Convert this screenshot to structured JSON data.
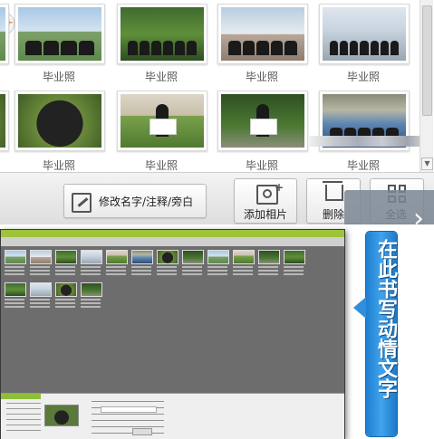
{
  "gallery": {
    "rows": [
      {
        "items": [
          {
            "caption": "毕业照",
            "scene": "jumping-students"
          },
          {
            "caption": "毕业照",
            "scene": "group-on-lawn"
          },
          {
            "caption": "毕业照",
            "scene": "group-at-monument"
          },
          {
            "caption": "毕业照",
            "scene": "group-on-steps"
          }
        ]
      },
      {
        "items": [
          {
            "caption": "毕业照",
            "scene": "circle-of-caps"
          },
          {
            "caption": "毕业照",
            "scene": "girl-with-sign"
          },
          {
            "caption": "毕业照",
            "scene": "girl-on-path"
          },
          {
            "caption": "毕业照",
            "scene": "group-under-arch"
          }
        ]
      }
    ],
    "partial_left_captions": [
      "照",
      "照"
    ]
  },
  "toolbar": {
    "rename_label": "修改名字/注释/旁白",
    "add_photo_label": "添加相片",
    "delete_label": "删除",
    "select_all_label": "全选"
  },
  "callout": {
    "text": "在此书写动情文字"
  },
  "colors": {
    "accent_blue": "#2f8fdd",
    "preview_bar_green": "#9dc43a"
  }
}
